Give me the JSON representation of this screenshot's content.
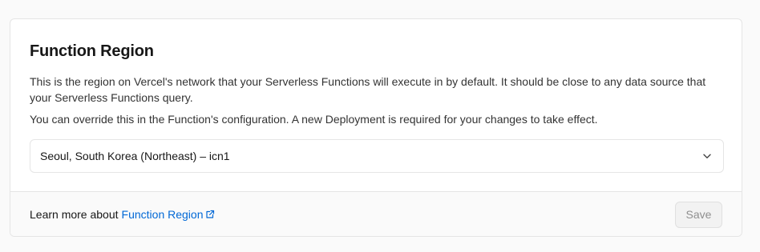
{
  "section": {
    "title": "Function Region",
    "description": "This is the region on Vercel's network that your Serverless Functions will execute in by default. It should be close to any data source that your Serverless Functions query.",
    "note": "You can override this in the Function's configuration. A new Deployment is required for your changes to take effect."
  },
  "region_select": {
    "selected": "Seoul, South Korea (Northeast) – icn1",
    "icon": "chevron-down-icon"
  },
  "footer": {
    "learn_prefix": "Learn more about",
    "learn_link": "Function Region",
    "link_icon": "external-link-icon",
    "save_label": "Save",
    "save_disabled": true
  },
  "colors": {
    "link": "#0068d6",
    "border": "#e5e5e5",
    "footer_bg": "#fafafa"
  }
}
